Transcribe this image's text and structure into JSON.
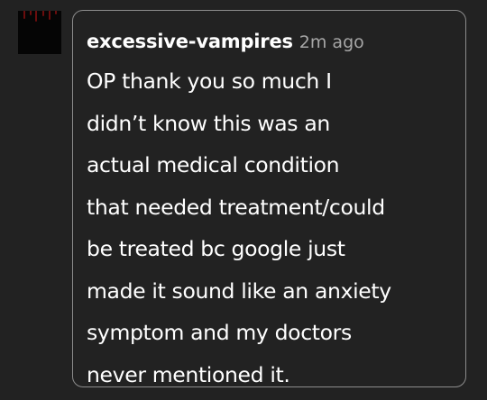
{
  "post": {
    "username": "excessive-vampires",
    "timestamp": "2m ago",
    "lines": [
      "OP thank you so much I",
      "didn’t know this was an",
      "actual medical condition",
      "that needed treatment/could",
      "be treated bc google just",
      "made it sound like an anxiety",
      "symptom and my doctors",
      "never mentioned it."
    ]
  },
  "colors": {
    "background": "#222222",
    "border": "#8c8c8c",
    "text": "#ffffff",
    "timestamp": "#a6a6a6",
    "avatar_accent": "#6b0d0d"
  },
  "icons": {
    "avatar": "avatar-image"
  }
}
